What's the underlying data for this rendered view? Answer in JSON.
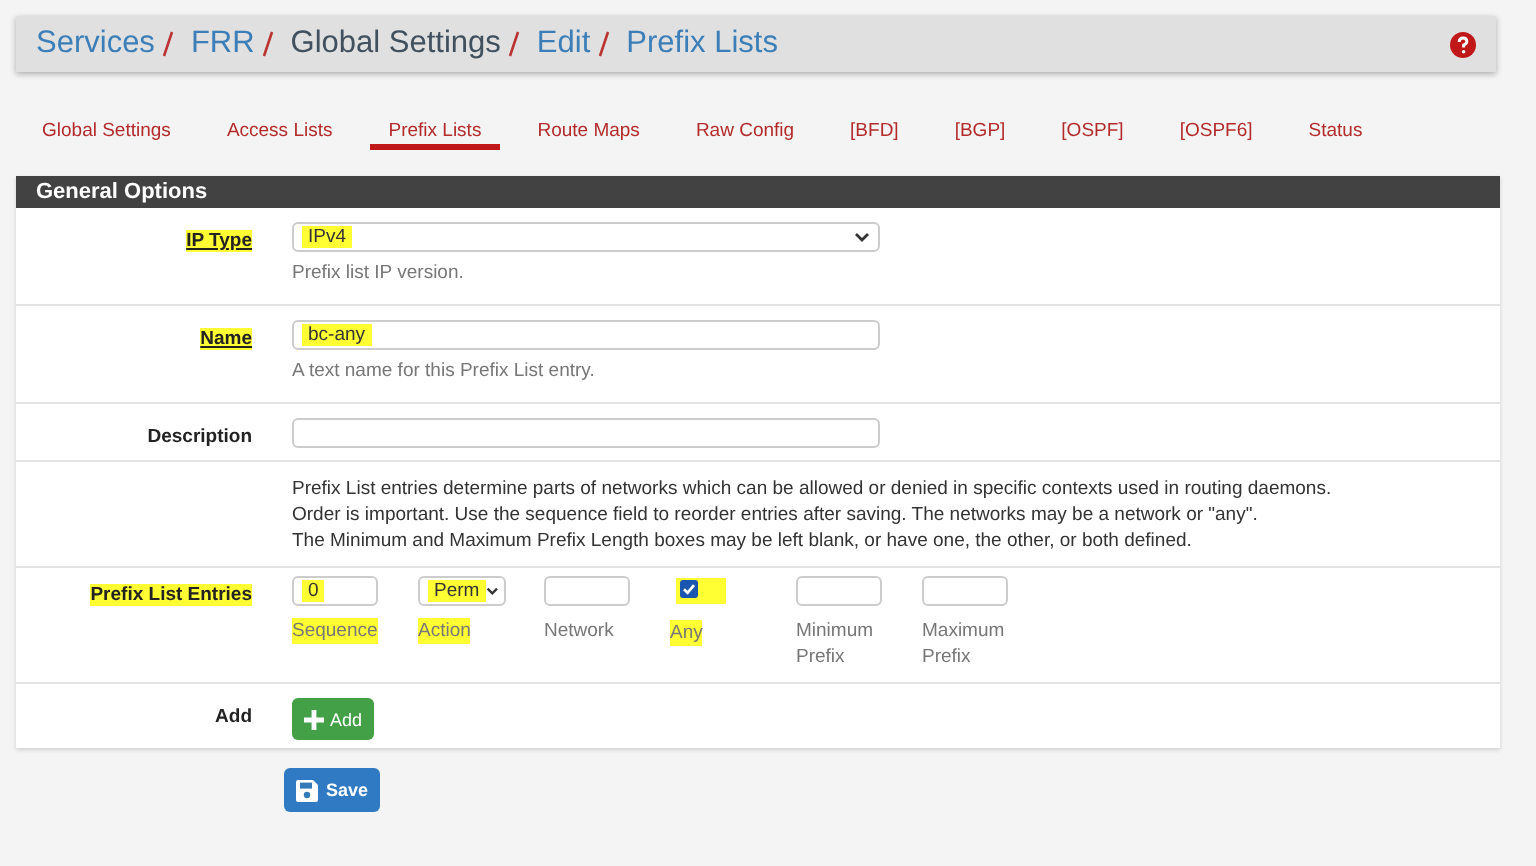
{
  "breadcrumb": [
    {
      "label": "Services",
      "link": true
    },
    {
      "label": "FRR",
      "link": true
    },
    {
      "label": "Global Settings",
      "link": false
    },
    {
      "label": "Edit",
      "link": true
    },
    {
      "label": "Prefix Lists",
      "link": true
    }
  ],
  "tabs": [
    {
      "label": "Global Settings",
      "selected": false
    },
    {
      "label": "Access Lists",
      "selected": false
    },
    {
      "label": "Prefix Lists",
      "selected": true
    },
    {
      "label": "Route Maps",
      "selected": false
    },
    {
      "label": "Raw Config",
      "selected": false
    },
    {
      "label": "[BFD]",
      "selected": false
    },
    {
      "label": "[BGP]",
      "selected": false
    },
    {
      "label": "[OSPF]",
      "selected": false
    },
    {
      "label": "[OSPF6]",
      "selected": false
    },
    {
      "label": "Status",
      "selected": false
    }
  ],
  "panel": {
    "title": "General Options",
    "fields": [
      {
        "label": "IP Type",
        "kind": "select",
        "value": "IPv4",
        "hint": "Prefix list IP version.",
        "highlighted": true
      },
      {
        "label": "Name",
        "kind": "text",
        "value": "bc-any",
        "hint": "A text name for this Prefix List entry.",
        "highlighted": true
      },
      {
        "label": "Description",
        "kind": "text",
        "highlighted": false
      }
    ],
    "info": [
      "Prefix List entries determine parts of networks which can be allowed or denied in specific contexts used in routing daemons.",
      "Order is important. Use the sequence field to reorder entries after saving. The networks may be a network or \"any\".",
      "The Minimum and Maximum Prefix Length boxes may be left blank, or have one, the other, or both defined."
    ],
    "entries": {
      "label": "Prefix List Entries",
      "highlighted": true,
      "columns": [
        {
          "kind": "text",
          "value": "0",
          "caption": "Sequence",
          "highlighted": true
        },
        {
          "kind": "select",
          "value": "Perm",
          "caption": "Action",
          "highlighted": true
        },
        {
          "kind": "text",
          "caption": "Network",
          "highlighted": false
        },
        {
          "kind": "checkbox",
          "checked": true,
          "caption": "Any",
          "highlighted": true
        },
        {
          "kind": "text",
          "caption": "Minimum Prefix",
          "highlighted": false
        },
        {
          "kind": "text",
          "caption": "Maximum Prefix",
          "highlighted": false
        }
      ]
    },
    "add": {
      "label": "Add",
      "button": "Add"
    }
  },
  "save_button": "Save"
}
